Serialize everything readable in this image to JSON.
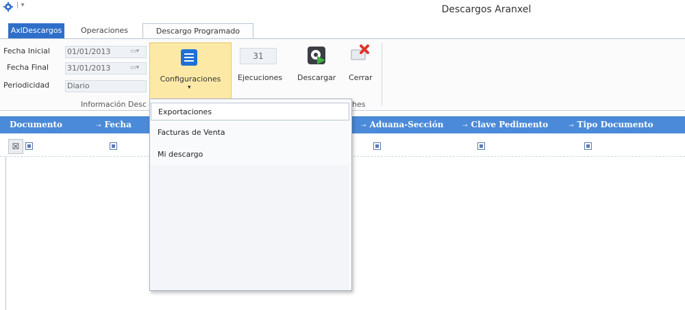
{
  "window": {
    "title": "Descargos Aranxel",
    "qa_separator": "|  ▾"
  },
  "tabs": [
    {
      "label": "AxlDescargos"
    },
    {
      "label": "Operaciones"
    },
    {
      "label": "Descargo Programado"
    }
  ],
  "ribbon": {
    "fields": {
      "fecha_inicial": {
        "label": "Fecha Inicial",
        "value": "01/01/2013"
      },
      "fecha_final": {
        "label": "Fecha Final",
        "value": "31/01/2013"
      },
      "periodicidad": {
        "label": "Periodicidad",
        "value": "Diario"
      }
    },
    "group_info_label": "Información Desc",
    "group_right_label": "hes",
    "config_label": "Configuraciones",
    "config_arrow": "▾",
    "executions_value": "31",
    "executions_label": "Ejecuciones",
    "download_label": "Descargar",
    "close_label": "Cerrar"
  },
  "grid": {
    "columns": [
      {
        "label": "Documento"
      },
      {
        "label": "Fecha"
      },
      {
        "label": "Aduana-Sección"
      },
      {
        "label": "Clave Pedimento"
      },
      {
        "label": "Tipo Documento"
      }
    ],
    "pin_glyph": "⊸",
    "clear_filter_glyph": "☒"
  },
  "dropdown": {
    "items": [
      {
        "label": "Exportaciones"
      },
      {
        "label": "Facturas de Venta"
      },
      {
        "label": "Mi descargo"
      }
    ]
  },
  "colors": {
    "accent_blue": "#2f6fc9",
    "header_blue": "#4b8ad8",
    "config_highlight": "#fde9a6"
  }
}
